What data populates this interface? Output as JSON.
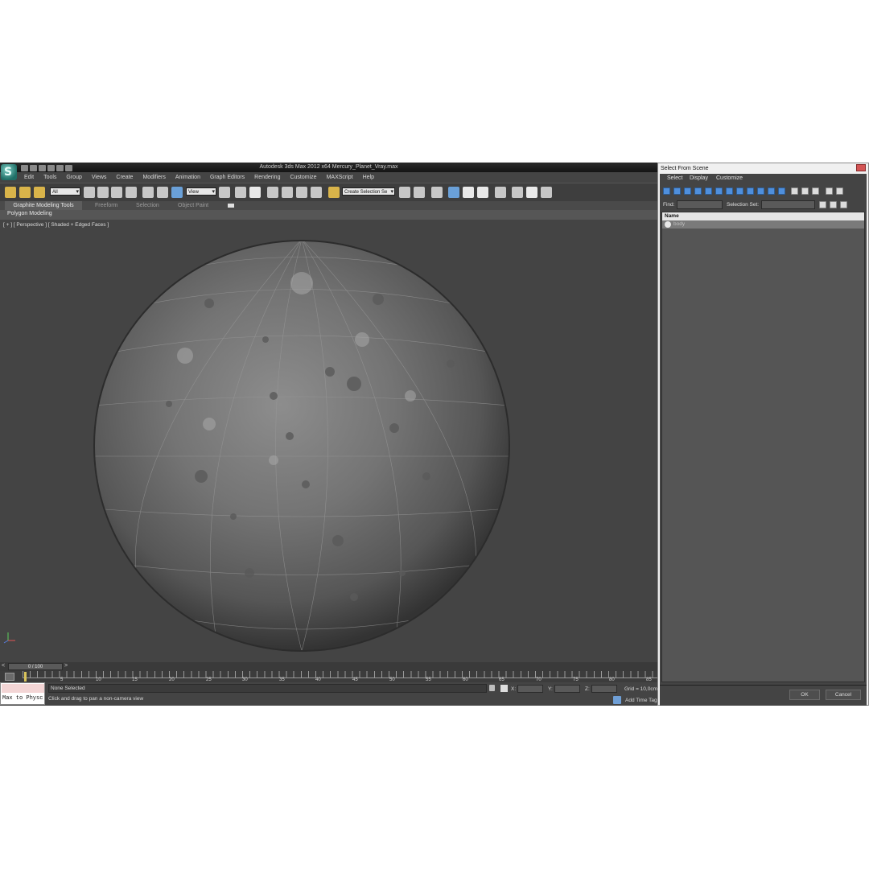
{
  "app": {
    "title": "Autodesk 3ds Max 2012 x64      Mercury_Planet_Vray.max",
    "logo_letter": "S",
    "menu": [
      "Edit",
      "Tools",
      "Group",
      "Views",
      "Create",
      "Modifiers",
      "Animation",
      "Graph Editors",
      "Rendering",
      "Customize",
      "MAXScript",
      "Help"
    ],
    "toolbar": {
      "filter_dropdown": "All",
      "reference_coord": "View",
      "selection_set": "Create Selection Se"
    },
    "ribbon": {
      "tabs": [
        "Graphite Modeling Tools",
        "Freeform",
        "Selection",
        "Object Paint"
      ],
      "panel_label": "Polygon Modeling"
    },
    "viewport": {
      "label": "[ + ] [ Perspective ] [ Shaded + Edged Faces ]",
      "object": "Mercury planet sphere"
    },
    "timeline": {
      "frame_display": "0 / 100",
      "prev": "<",
      "next": ">",
      "ticks": [
        "5",
        "10",
        "15",
        "20",
        "25",
        "30",
        "35",
        "40",
        "45",
        "50",
        "55",
        "60",
        "65",
        "70",
        "75",
        "80",
        "85"
      ]
    },
    "status": {
      "script_text": "Max to Physc",
      "selection": "None Selected",
      "prompt": "Click and drag to pan a non-camera view",
      "x_label": "X:",
      "y_label": "Y:",
      "z_label": "Z:",
      "grid": "Grid = 10,0cm",
      "add_time_tag": "Add Time Tag"
    }
  },
  "dialog": {
    "title": "Select From Scene",
    "menu": [
      "Select",
      "Display",
      "Customize"
    ],
    "find_label": "Find:",
    "selection_set_label": "Selection Set:",
    "column_header": "Name",
    "rows": [
      "body"
    ],
    "ok": "OK",
    "cancel": "Cancel"
  },
  "colors": {
    "ui_dark": "#444444",
    "accent_blue": "#4f8fdc",
    "key_yellow": "#d8c35b"
  }
}
